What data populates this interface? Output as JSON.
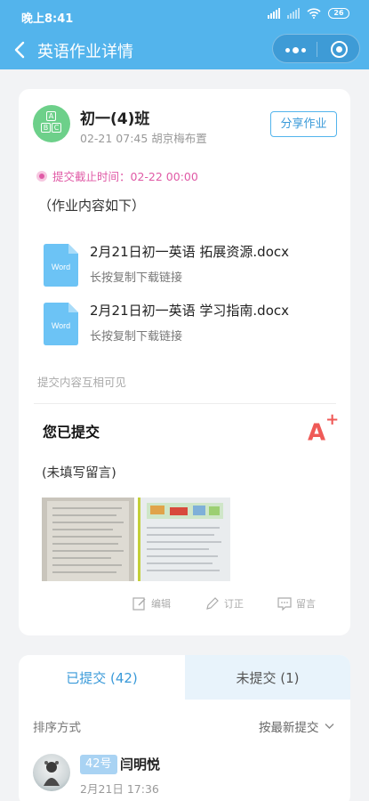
{
  "status_bar": {
    "time": "晚上8:41",
    "battery": "26"
  },
  "nav": {
    "title": "英语作业详情"
  },
  "assignment": {
    "class_name": "初一(4)班",
    "meta": "02-21 07:45 胡京梅布置",
    "share_label": "分享作业",
    "deadline": "提交截止时间：02-22 00:00",
    "content_hint": "（作业内容如下）",
    "files": [
      {
        "type_label": "Word",
        "name": "2月21日初一英语 拓展资源.docx",
        "hint": "长按复制下载链接"
      },
      {
        "type_label": "Word",
        "name": "2月21日初一英语 学习指南.docx",
        "hint": "长按复制下载链接"
      }
    ],
    "visibility_note": "提交内容互相可见"
  },
  "submission": {
    "title": "您已提交",
    "grade": "A",
    "grade_plus": "+",
    "comment": "(未填写留言)",
    "actions": {
      "edit": "编辑",
      "revise": "订正",
      "message": "留言"
    }
  },
  "list": {
    "tabs": {
      "submitted": "已提交 (42)",
      "unsubmitted": "未提交 (1)"
    },
    "sort_label": "排序方式",
    "sort_value": "按最新提交",
    "students": [
      {
        "number": "42号",
        "name": "闫明悦",
        "time": "2月21日 17:36"
      }
    ]
  },
  "colors": {
    "accent": "#53b4ec",
    "deadline": "#e05aa6",
    "grade": "#ef5a57",
    "class_avatar": "#6dd08a"
  }
}
